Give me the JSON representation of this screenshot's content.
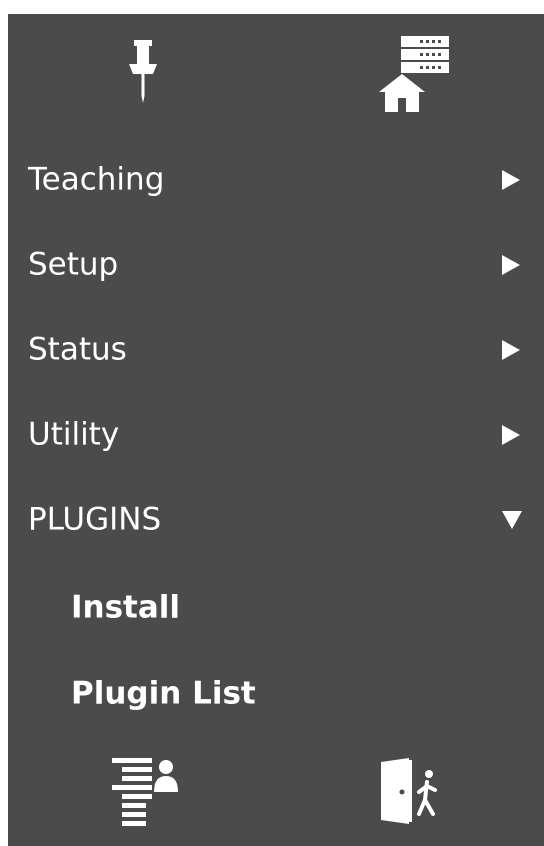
{
  "toolbar": {
    "pin_icon": "pin-icon",
    "home_server_icon": "home-server-icon"
  },
  "menu": {
    "items": [
      {
        "label": "Teaching",
        "arrow": "right"
      },
      {
        "label": "Setup",
        "arrow": "right"
      },
      {
        "label": "Status",
        "arrow": "right"
      },
      {
        "label": "Utility",
        "arrow": "right"
      },
      {
        "label": "PLUGINS",
        "arrow": "down",
        "expanded": true
      }
    ],
    "subitems": [
      {
        "label": "Install"
      },
      {
        "label": "Plugin List"
      }
    ]
  },
  "footer": {
    "user_list_icon": "user-list-icon",
    "exit_icon": "exit-icon"
  },
  "colors": {
    "panel_bg": "#4b4b4b",
    "text": "#ffffff"
  }
}
